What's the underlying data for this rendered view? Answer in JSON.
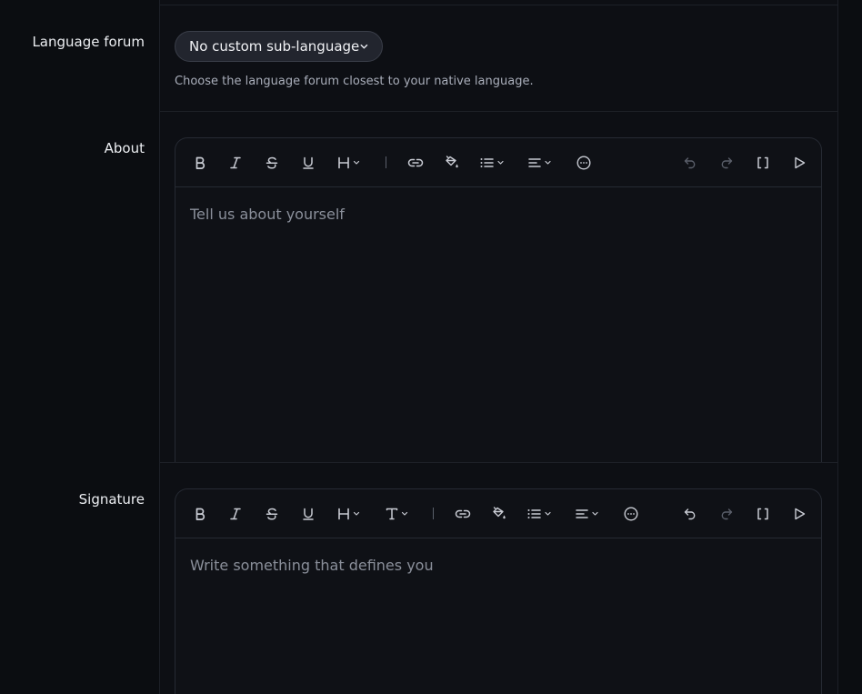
{
  "language_forum": {
    "label": "Language forum",
    "selected": "No custom sub-language",
    "hint": "Choose the language forum closest to your native language."
  },
  "about": {
    "label": "About",
    "placeholder": "Tell us about yourself"
  },
  "signature": {
    "label": "Signature",
    "placeholder": "Write something that defines you"
  },
  "icons": {
    "bold": "bold-icon",
    "italic": "italic-icon",
    "strike": "strikethrough-icon",
    "underline": "underline-icon",
    "heading": "heading-icon",
    "text": "text-size-icon",
    "link": "link-icon",
    "paint": "paint-bucket-icon",
    "list": "list-icon",
    "align": "align-icon",
    "more": "more-icon",
    "undo": "undo-icon",
    "redo": "redo-icon",
    "brackets": "brackets-icon",
    "play": "play-icon"
  },
  "colors": {
    "background": "#0d0f14",
    "border": "#262a33",
    "button": "#22252e"
  }
}
